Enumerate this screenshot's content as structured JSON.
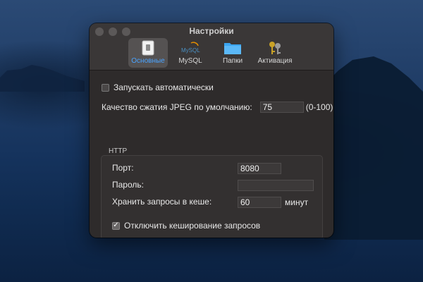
{
  "window": {
    "title": "Настройки"
  },
  "tabs": [
    {
      "label": "Основные",
      "icon": "switch-icon",
      "active": true
    },
    {
      "label": "MySQL",
      "icon": "mysql-icon",
      "active": false
    },
    {
      "label": "Папки",
      "icon": "folder-icon",
      "active": false
    },
    {
      "label": "Активация",
      "icon": "keys-icon",
      "active": false
    }
  ],
  "mysql_logo_text": "MySQL",
  "general": {
    "autostart_label": "Запускать автоматически",
    "autostart_checked": false,
    "jpeg_label": "Качество сжатия JPEG по умолчанию:",
    "jpeg_value": "75",
    "jpeg_range": "(0-100)"
  },
  "http": {
    "group_title": "HTTP",
    "port_label": "Порт:",
    "port_value": "8080",
    "password_label": "Пароль:",
    "password_value": "",
    "cache_label": "Хранить запросы в кеше:",
    "cache_value": "60",
    "cache_unit": "минут",
    "disable_cache_label": "Отключить кеширование запросов",
    "disable_cache_checked": true
  },
  "colors": {
    "accent": "#4aa3ff",
    "window_bg": "#2e2b2b",
    "folder": "#3aa4f0"
  }
}
